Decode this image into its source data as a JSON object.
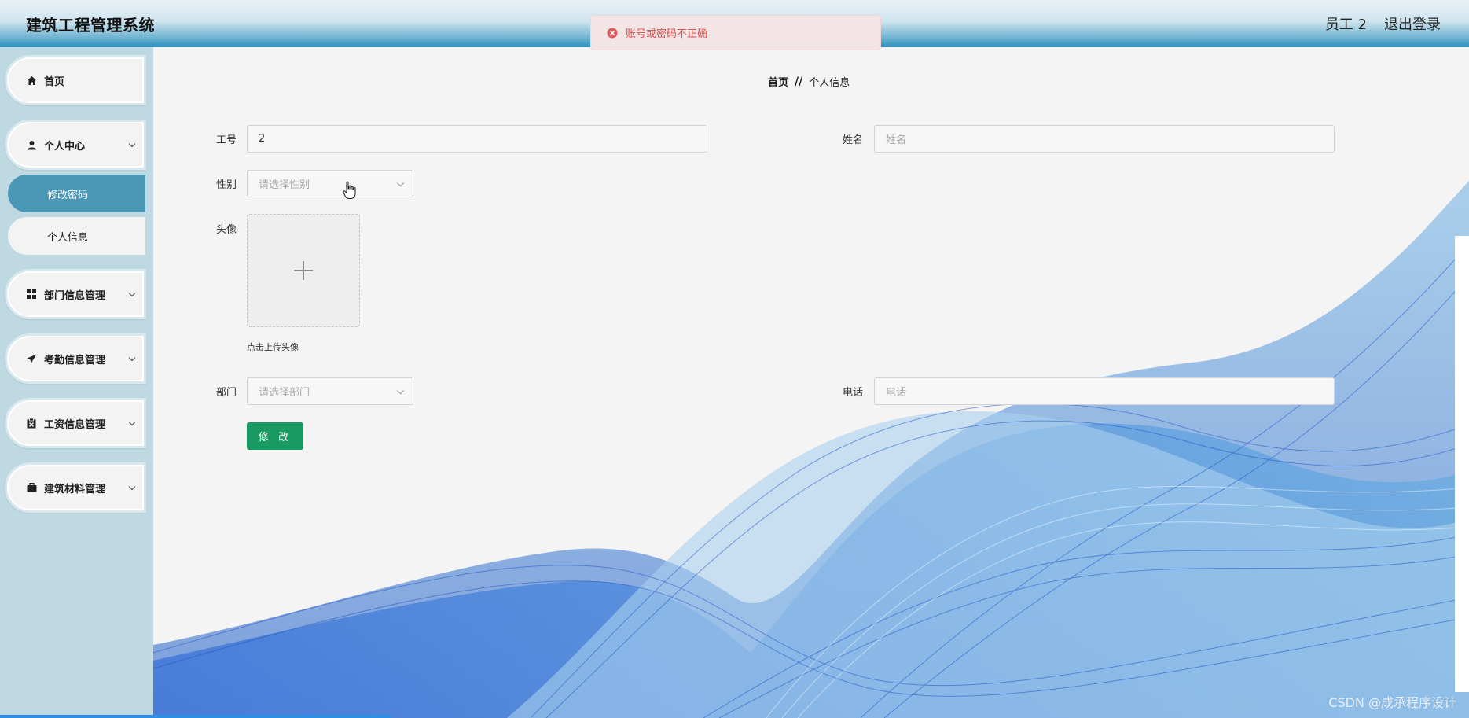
{
  "header": {
    "title": "建筑工程管理系统",
    "user": "员工 2",
    "logout": "退出登录"
  },
  "toast": {
    "message": "账号或密码不正确",
    "icon": "error-circle-icon",
    "color": "#d9534f"
  },
  "sidebar": {
    "items": [
      {
        "label": "首页",
        "icon": "home-icon"
      },
      {
        "label": "个人中心",
        "icon": "user-icon",
        "sub": [
          "修改密码",
          "个人信息"
        ],
        "active_sub": 0
      },
      {
        "label": "部门信息管理",
        "icon": "grid-icon"
      },
      {
        "label": "考勤信息管理",
        "icon": "paper-plane-icon"
      },
      {
        "label": "工资信息管理",
        "icon": "clipboard-icon"
      },
      {
        "label": "建筑材料管理",
        "icon": "briefcase-icon"
      }
    ]
  },
  "breadcrumb": {
    "home": "首页",
    "separator": "//",
    "current": "个人信息"
  },
  "form": {
    "emp_no_label": "工号",
    "emp_no_value": "2",
    "name_label": "姓名",
    "name_placeholder": "姓名",
    "gender_label": "性别",
    "gender_placeholder": "请选择性别",
    "avatar_label": "头像",
    "avatar_tip": "点击上传头像",
    "dept_label": "部门",
    "dept_placeholder": "请选择部门",
    "phone_label": "电话",
    "phone_placeholder": "电话",
    "submit_label": "修 改"
  },
  "watermark": "CSDN @成承程序设计",
  "colors": {
    "accent": "#4a97b6",
    "submit": "#1a9a63",
    "sidebar_bg": "#bfd9e2",
    "wave": "#1f6fd0"
  }
}
